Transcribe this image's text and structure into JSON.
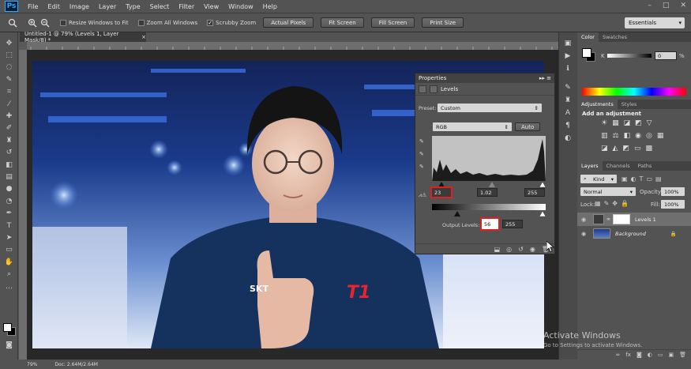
{
  "app": {
    "logo": "Ps"
  },
  "menu": [
    "File",
    "Edit",
    "Image",
    "Layer",
    "Type",
    "Select",
    "Filter",
    "View",
    "Window",
    "Help"
  ],
  "window_controls": [
    "–",
    "□",
    "✕"
  ],
  "options_bar": {
    "resize_windows": "Resize Windows to Fit",
    "zoom_all": "Zoom All Windows",
    "scrubby_zoom": "Scrubby Zoom",
    "actual_pixels": "Actual Pixels",
    "fit_screen": "Fit Screen",
    "fill_screen": "Fill Screen",
    "print_size": "Print Size",
    "workspace": "Essentials"
  },
  "document": {
    "tab_title": "Untitled-1 @ 79% (Levels 1, Layer Mask/8) *",
    "close": "×"
  },
  "status": {
    "zoom": "79%",
    "doc": "Doc: 2.64M/2.64M"
  },
  "properties": {
    "tab": "Properties",
    "title": "Levels",
    "preset_label": "Preset:",
    "preset_value": "Custom",
    "channel": "RGB",
    "auto_label": "Auto",
    "input_black": "23",
    "input_mid": "1.02",
    "input_white": "255",
    "output_label": "Output Levels:",
    "output_black": "56",
    "output_white": "255"
  },
  "color_panel": {
    "tabs": [
      "Color",
      "Swatches"
    ],
    "k_label": "K",
    "k_value": "0",
    "k_unit": "%"
  },
  "adjustments_panel": {
    "tabs": [
      "Adjustments",
      "Styles"
    ],
    "heading": "Add an adjustment"
  },
  "layers_panel": {
    "tabs": [
      "Layers",
      "Channels",
      "Paths"
    ],
    "kind": "Kind",
    "blend_mode": "Normal",
    "opacity_label": "Opacity:",
    "opacity_value": "100%",
    "lock_label": "Lock:",
    "fill_label": "Fill:",
    "fill_value": "100%",
    "layers": [
      {
        "name": "Levels 1"
      },
      {
        "name": "Background"
      }
    ]
  },
  "photo_text": {
    "jersey": "SKT",
    "logo": "T1"
  },
  "activation": {
    "title": "Activate Windows",
    "subtitle": "Go to Settings to activate Windows."
  }
}
